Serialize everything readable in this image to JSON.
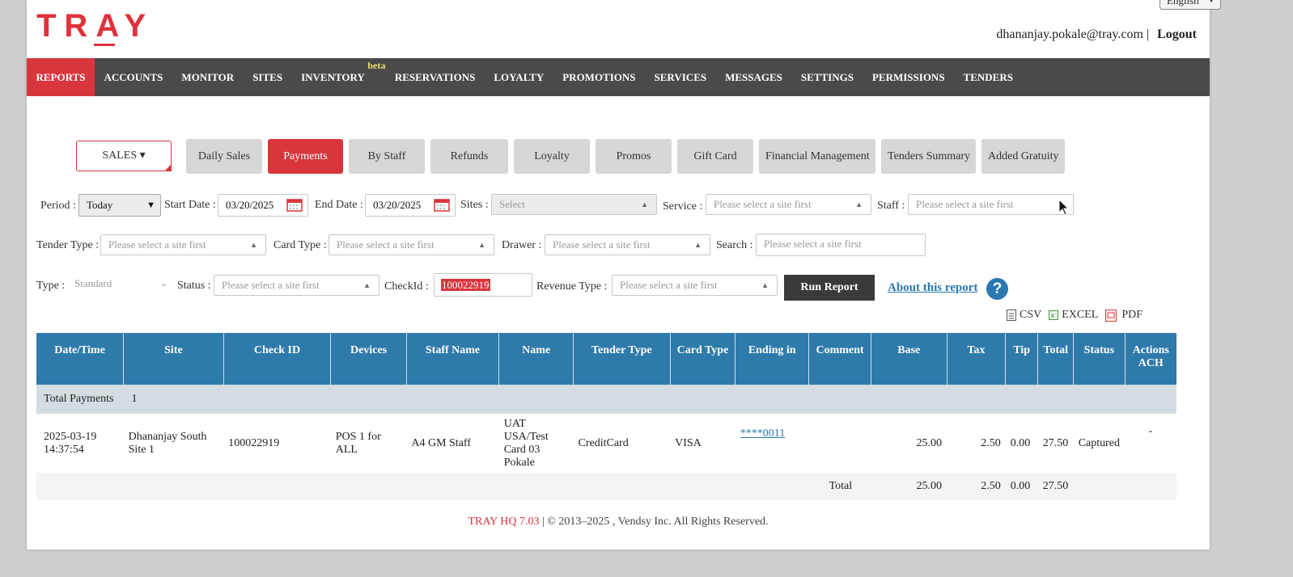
{
  "header": {
    "language": "English",
    "logo_text": "TRAY",
    "user_email": "dhananjay.pokale@tray.com",
    "separator": "|",
    "logout_label": "Logout"
  },
  "nav": {
    "items": [
      {
        "label": "REPORTS",
        "active": true
      },
      {
        "label": "ACCOUNTS"
      },
      {
        "label": "MONITOR"
      },
      {
        "label": "SITES"
      },
      {
        "label": "INVENTORY",
        "badge": "beta"
      },
      {
        "label": "RESERVATIONS"
      },
      {
        "label": "LOYALTY"
      },
      {
        "label": "PROMOTIONS"
      },
      {
        "label": "SERVICES"
      },
      {
        "label": "MESSAGES"
      },
      {
        "label": "SETTINGS"
      },
      {
        "label": "PERMISSIONS"
      },
      {
        "label": "TENDERS"
      }
    ]
  },
  "report_tabs": {
    "dropdown_label": "SALES ▾",
    "items": [
      {
        "label": "Daily Sales"
      },
      {
        "label": "Payments",
        "active": true
      },
      {
        "label": "By Staff"
      },
      {
        "label": "Refunds"
      },
      {
        "label": "Loyalty"
      },
      {
        "label": "Promos"
      },
      {
        "label": "Gift Card"
      },
      {
        "label": "Financial Management"
      },
      {
        "label": "Tenders Summary"
      },
      {
        "label": "Added Gratuity"
      }
    ]
  },
  "filters": {
    "period_label": "Period :",
    "period_value": "Today",
    "start_date_label": "Start Date :",
    "start_date_value": "03/20/2025",
    "end_date_label": "End Date :",
    "end_date_value": "03/20/2025",
    "sites_label": "Sites :",
    "sites_placeholder": "Select",
    "service_label": "Service :",
    "service_placeholder": "Please select a site first",
    "staff_label": "Staff :",
    "staff_placeholder": "Please select a site first",
    "tender_type_label": "Tender Type :",
    "tender_type_placeholder": "Please select a site first",
    "card_type_label": "Card Type :",
    "card_type_placeholder": "Please select a site first",
    "drawer_label": "Drawer :",
    "drawer_placeholder": "Please select a site first",
    "search_label": "Search :",
    "search_placeholder": "Please select a site first",
    "type_label": "Type :",
    "type_value": "Standard",
    "status_label": "Status :",
    "status_placeholder": "Please select a site first",
    "checkid_label": "CheckId :",
    "checkid_value": "100022919",
    "revenue_type_label": "Revenue Type :",
    "revenue_type_placeholder": "Please select a site first",
    "run_report_label": "Run Report",
    "about_label": "About this report",
    "help_symbol": "?"
  },
  "exports": {
    "csv": "CSV",
    "excel": "EXCEL",
    "pdf": "PDF"
  },
  "table": {
    "headers": [
      "Date/Time",
      "Site",
      "Check ID",
      "Devices",
      "Staff Name",
      "Name",
      "Tender Type",
      "Card Type",
      "Ending in",
      "Comment",
      "Base",
      "Tax",
      "Tip",
      "Total",
      "Status",
      "Actions",
      "ACH"
    ],
    "summary_label": "Total Payments",
    "summary_count": "1",
    "rows": [
      {
        "datetime_date": "2025-03-19",
        "datetime_time": "14:37:54",
        "site_line1": "Dhananjay South",
        "site_line2": "Site 1",
        "check_id": "100022919",
        "devices": "POS 1 for ALL",
        "staff_name": "A4 GM Staff",
        "name_line1": "UAT USA/Test",
        "name_line2": "Card 03 Pokale",
        "tender_type": "CreditCard",
        "card_type": "VISA",
        "ending_in": "****0011",
        "comment": "",
        "base": "25.00",
        "tax": "2.50",
        "tip": "0.00",
        "total": "27.50",
        "status": "Captured",
        "actions": "-"
      }
    ],
    "totals": {
      "label": "Total",
      "base": "25.00",
      "tax": "2.50",
      "tip": "0.00",
      "total": "27.50"
    }
  },
  "footer": {
    "brand": "TRAY HQ 7.03",
    "text": " | © 2013–2025 , Vendsy Inc. All Rights Reserved."
  }
}
